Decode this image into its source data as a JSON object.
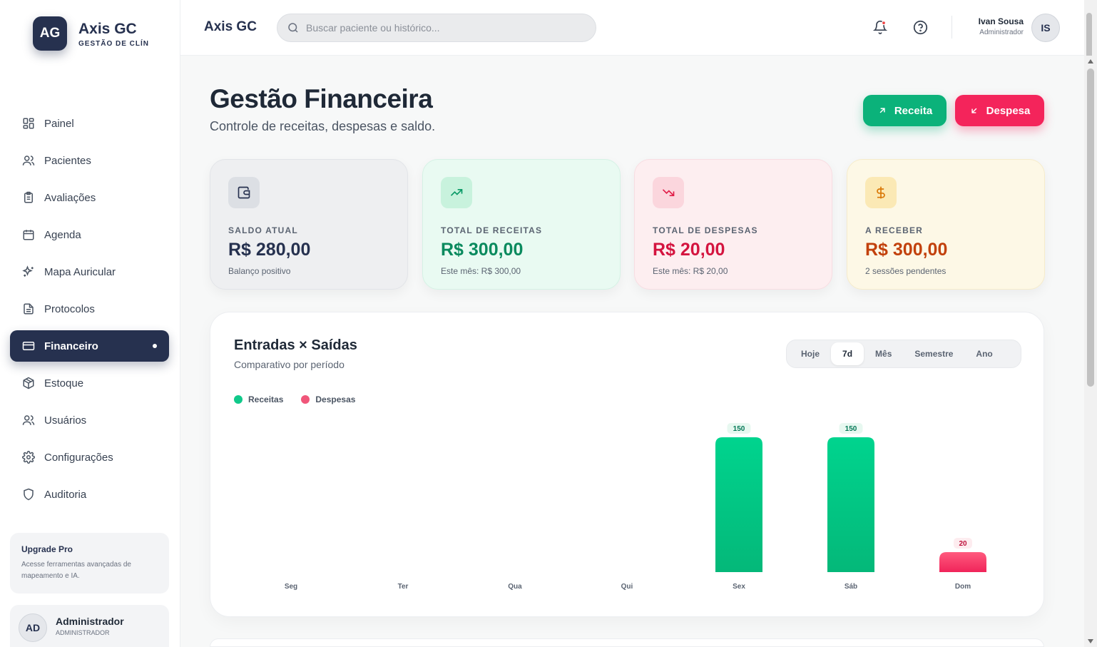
{
  "brand": {
    "initials": "AG",
    "name": "Axis GC",
    "subtitle": "GESTÃO DE CLÍN"
  },
  "sidebar": {
    "items": [
      {
        "label": "Painel",
        "icon": "dashboard-icon"
      },
      {
        "label": "Pacientes",
        "icon": "users-icon"
      },
      {
        "label": "Avaliações",
        "icon": "clipboard-icon"
      },
      {
        "label": "Agenda",
        "icon": "calendar-icon"
      },
      {
        "label": "Mapa Auricular",
        "icon": "sparkles-icon"
      },
      {
        "label": "Protocolos",
        "icon": "file-text-icon"
      },
      {
        "label": "Financeiro",
        "icon": "credit-card-icon",
        "active": true
      },
      {
        "label": "Estoque",
        "icon": "package-icon"
      },
      {
        "label": "Usuários",
        "icon": "users-icon"
      },
      {
        "label": "Configurações",
        "icon": "gear-icon"
      },
      {
        "label": "Auditoria",
        "icon": "shield-icon"
      }
    ],
    "upgrade": {
      "title": "Upgrade Pro",
      "text": "Acesse ferramentas avançadas de mapeamento e IA."
    },
    "account": {
      "initials": "AD",
      "name": "Administrador",
      "role": "ADMINISTRADOR"
    }
  },
  "topbar": {
    "title": "Axis GC",
    "search_placeholder": "Buscar paciente ou histórico...",
    "user": {
      "name": "Ivan Sousa",
      "role": "Administrador",
      "initials": "IS"
    }
  },
  "page": {
    "title": "Gestão Financeira",
    "subtitle": "Controle de receitas, despesas e saldo.",
    "btn_receita": "Receita",
    "btn_despesa": "Despesa"
  },
  "cards": [
    {
      "label": "SALDO ATUAL",
      "value": "R$ 280,00",
      "sub": "Balanço positivo",
      "icon": "wallet-icon"
    },
    {
      "label": "TOTAL DE RECEITAS",
      "value": "R$ 300,00",
      "sub": "Este mês: R$ 300,00",
      "icon": "trending-up-icon"
    },
    {
      "label": "TOTAL DE DESPESAS",
      "value": "R$ 20,00",
      "sub": "Este mês: R$ 20,00",
      "icon": "trending-down-icon"
    },
    {
      "label": "A RECEBER",
      "value": "R$ 300,00",
      "sub": "2 sessões pendentes",
      "icon": "dollar-icon"
    }
  ],
  "chart_panel": {
    "title": "Entradas × Saídas",
    "subtitle": "Comparativo por período",
    "periods": [
      "Hoje",
      "7d",
      "Mês",
      "Semestre",
      "Ano"
    ],
    "active_period": "7d",
    "legend": [
      {
        "name": "Receitas",
        "color": "#10c98a"
      },
      {
        "name": "Despesas",
        "color": "#f0567a"
      }
    ]
  },
  "chart_data": {
    "type": "bar",
    "categories": [
      "Seg",
      "Ter",
      "Qua",
      "Qui",
      "Sex",
      "Sáb",
      "Dom"
    ],
    "series": [
      {
        "name": "Receitas",
        "values": [
          0,
          0,
          0,
          0,
          150,
          150,
          0
        ],
        "color": "#10c98a"
      },
      {
        "name": "Despesas",
        "values": [
          0,
          0,
          0,
          0,
          0,
          0,
          20
        ],
        "color": "#f0567a"
      }
    ],
    "ylim": [
      0,
      150
    ],
    "grid": false,
    "legend_position": "top-left"
  }
}
